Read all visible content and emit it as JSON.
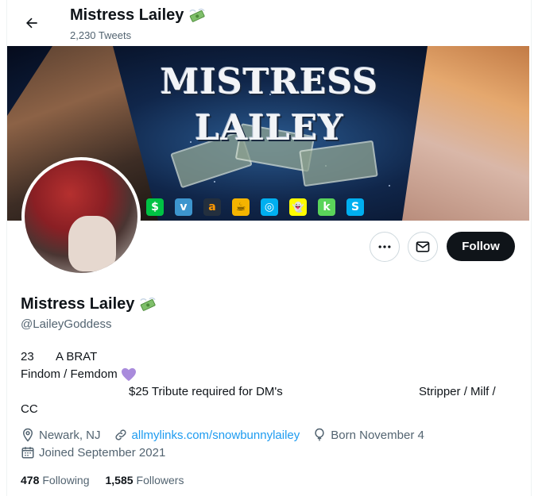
{
  "header": {
    "back_icon": "arrow-left-icon",
    "name": "Mistress Lailey",
    "tweets": "2,230 Tweets"
  },
  "banner": {
    "title_line1": "MISTRESS",
    "title_line2": "LAILEY",
    "icons": [
      {
        "name": "cashapp-icon",
        "glyph": "$",
        "color": "#00c244"
      },
      {
        "name": "venmo-icon",
        "glyph": "v",
        "color": "#3d95ce"
      },
      {
        "name": "amazon-icon",
        "glyph": "a",
        "color": "#232f3e"
      },
      {
        "name": "starbucks-icon",
        "glyph": "☕",
        "color": "#f4b400"
      },
      {
        "name": "onlyfans-icon",
        "glyph": "◎",
        "color": "#00aff0"
      },
      {
        "name": "snapchat-icon",
        "glyph": "👻",
        "color": "#fffc00"
      },
      {
        "name": "kik-icon",
        "glyph": "k",
        "color": "#5ad45a"
      },
      {
        "name": "skype-icon",
        "glyph": "S",
        "color": "#00aff0"
      }
    ]
  },
  "actions": {
    "more_icon": "more-dots-icon",
    "message_icon": "envelope-icon",
    "follow_label": "Follow"
  },
  "profile": {
    "name": "Mistress Lailey",
    "handle": "@LaileyGoddess",
    "bio": {
      "age": "23",
      "tag": "A BRAT",
      "line2": "Findom / Femdom",
      "tribute": "$25 Tribute required for DM's",
      "tail": "Stripper / Milf /",
      "line4": "CC"
    },
    "location": "Newark, NJ",
    "link": "allmylinks.com/snowbunnylailey",
    "born": "Born November 4",
    "joined": "Joined September 2021",
    "following_count": "478",
    "following_label": "Following",
    "followers_count": "1,585",
    "followers_label": "Followers"
  },
  "colors": {
    "text": "#0f1419",
    "muted": "#536471",
    "link": "#1d9bf0",
    "follow_bg": "#0f1419",
    "heart": "#a98bdc"
  }
}
